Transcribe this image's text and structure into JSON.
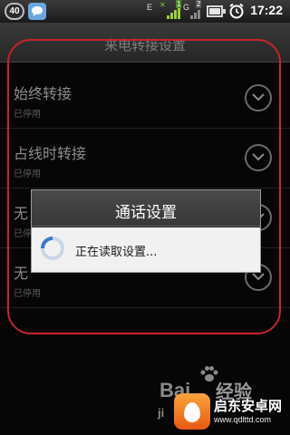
{
  "status_bar": {
    "badge": "40",
    "app_icon": "chat-bubble-icon",
    "signal1_label": "E",
    "signal1_sub": "1",
    "signal2_label": "G",
    "signal2_sub": "2",
    "battery_icon": "battery-icon",
    "alarm_icon": "alarm-clock-icon",
    "time": "17:22"
  },
  "settings": {
    "title": "来电转接设置",
    "rows": [
      {
        "title": "始终转接",
        "status": "已停用",
        "icon": "chevron-down-icon"
      },
      {
        "title": "占线时转接",
        "status": "已停用",
        "icon": "chevron-down-icon"
      },
      {
        "title": "无",
        "status": "已停用",
        "icon": "chevron-down-icon"
      },
      {
        "title": "无",
        "status": "已停用",
        "icon": "chevron-down-icon"
      }
    ]
  },
  "dialog": {
    "title": "通话设置",
    "message": "正在读取设置...",
    "spinner_icon": "loading-spinner-icon"
  },
  "watermark": {
    "bai": "Bai",
    "jingyan": "经验",
    "ji": "ji",
    "brand": "启东安卓网",
    "url": "www.qdlttd.com"
  },
  "colors": {
    "annotation_outline": "#c8232c",
    "status_bar": "#1a1a1a",
    "dialog_body": "#f1f1f1"
  }
}
